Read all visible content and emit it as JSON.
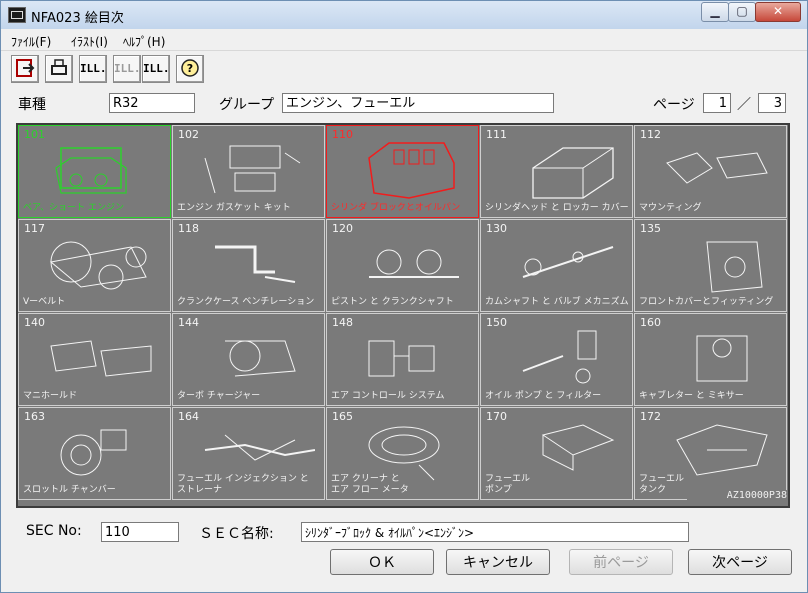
{
  "window": {
    "title": "NFA023 絵目次"
  },
  "menu": {
    "file": "ﾌｧｲﾙ(F)",
    "illust": "ｲﾗｽﾄ(I)",
    "help": "ﾍﾙﾌﾟ(H)"
  },
  "toolbar": {
    "ill": "ILL.",
    "prev_ill": "ILL.",
    "next_ill": "ILL."
  },
  "header": {
    "car_label": "車種",
    "car_value": "R32",
    "group_label": "グループ",
    "group_value": "エンジン、フューエル",
    "page_label": "ページ",
    "page_current": "1",
    "page_sep": "／",
    "page_total": "3"
  },
  "cells": [
    {
      "num": "101",
      "name": "ベア、ショート エンジン",
      "state": "green"
    },
    {
      "num": "102",
      "name": "エンジン ガスケット キット",
      "state": ""
    },
    {
      "num": "110",
      "name": "シリンダ ブロックとオイルパン",
      "state": "red"
    },
    {
      "num": "111",
      "name": "シリンダヘッド と ロッカー カバー",
      "state": ""
    },
    {
      "num": "112",
      "name": "マウンティング",
      "state": ""
    },
    {
      "num": "117",
      "name": "Vーベルト",
      "state": ""
    },
    {
      "num": "118",
      "name": "クランクケース ベンチレーション",
      "state": ""
    },
    {
      "num": "120",
      "name": "ピストン と クランクシャフト",
      "state": ""
    },
    {
      "num": "130",
      "name": "カムシャフト と バルブ メカニズム",
      "state": ""
    },
    {
      "num": "135",
      "name": "フロントカバーとフィッティング",
      "state": ""
    },
    {
      "num": "140",
      "name": "マニホールド",
      "state": ""
    },
    {
      "num": "144",
      "name": "ターボ チャージャー",
      "state": ""
    },
    {
      "num": "148",
      "name": "エア コントロール システム",
      "state": ""
    },
    {
      "num": "150",
      "name": "オイル ポンプ と フィルター",
      "state": ""
    },
    {
      "num": "160",
      "name": "キャブレター と ミキサー",
      "state": ""
    },
    {
      "num": "163",
      "name": "スロットル チャンバー",
      "state": ""
    },
    {
      "num": "164",
      "name": "フューエル インジェクション と\nストレーナ",
      "state": ""
    },
    {
      "num": "165",
      "name": "エア クリーナ と\nエア フロー メータ",
      "state": ""
    },
    {
      "num": "170",
      "name": "フューエル\nポンプ",
      "state": ""
    },
    {
      "num": "172",
      "name": "フューエル\nタンク",
      "state": ""
    }
  ],
  "copyright": "AZ10000P38",
  "footer": {
    "sec_no_label": "SEC No:",
    "sec_no_value": "110",
    "sec_name_label": "ＳＥＣ名称:",
    "sec_name_value": "ｼﾘﾝﾀﾞｰﾌﾞﾛｯｸ & ｵｲﾙﾊﾟﾝ<ｴﾝｼﾞﾝ>"
  },
  "buttons": {
    "ok": "ＯＫ",
    "cancel": "キャンセル",
    "prev_page": "前ページ",
    "next_page": "次ページ"
  },
  "colors": {
    "grid_bg": "#7a7a7a",
    "selected_green": "#2cd12c",
    "selected_red": "#f21c1c"
  }
}
